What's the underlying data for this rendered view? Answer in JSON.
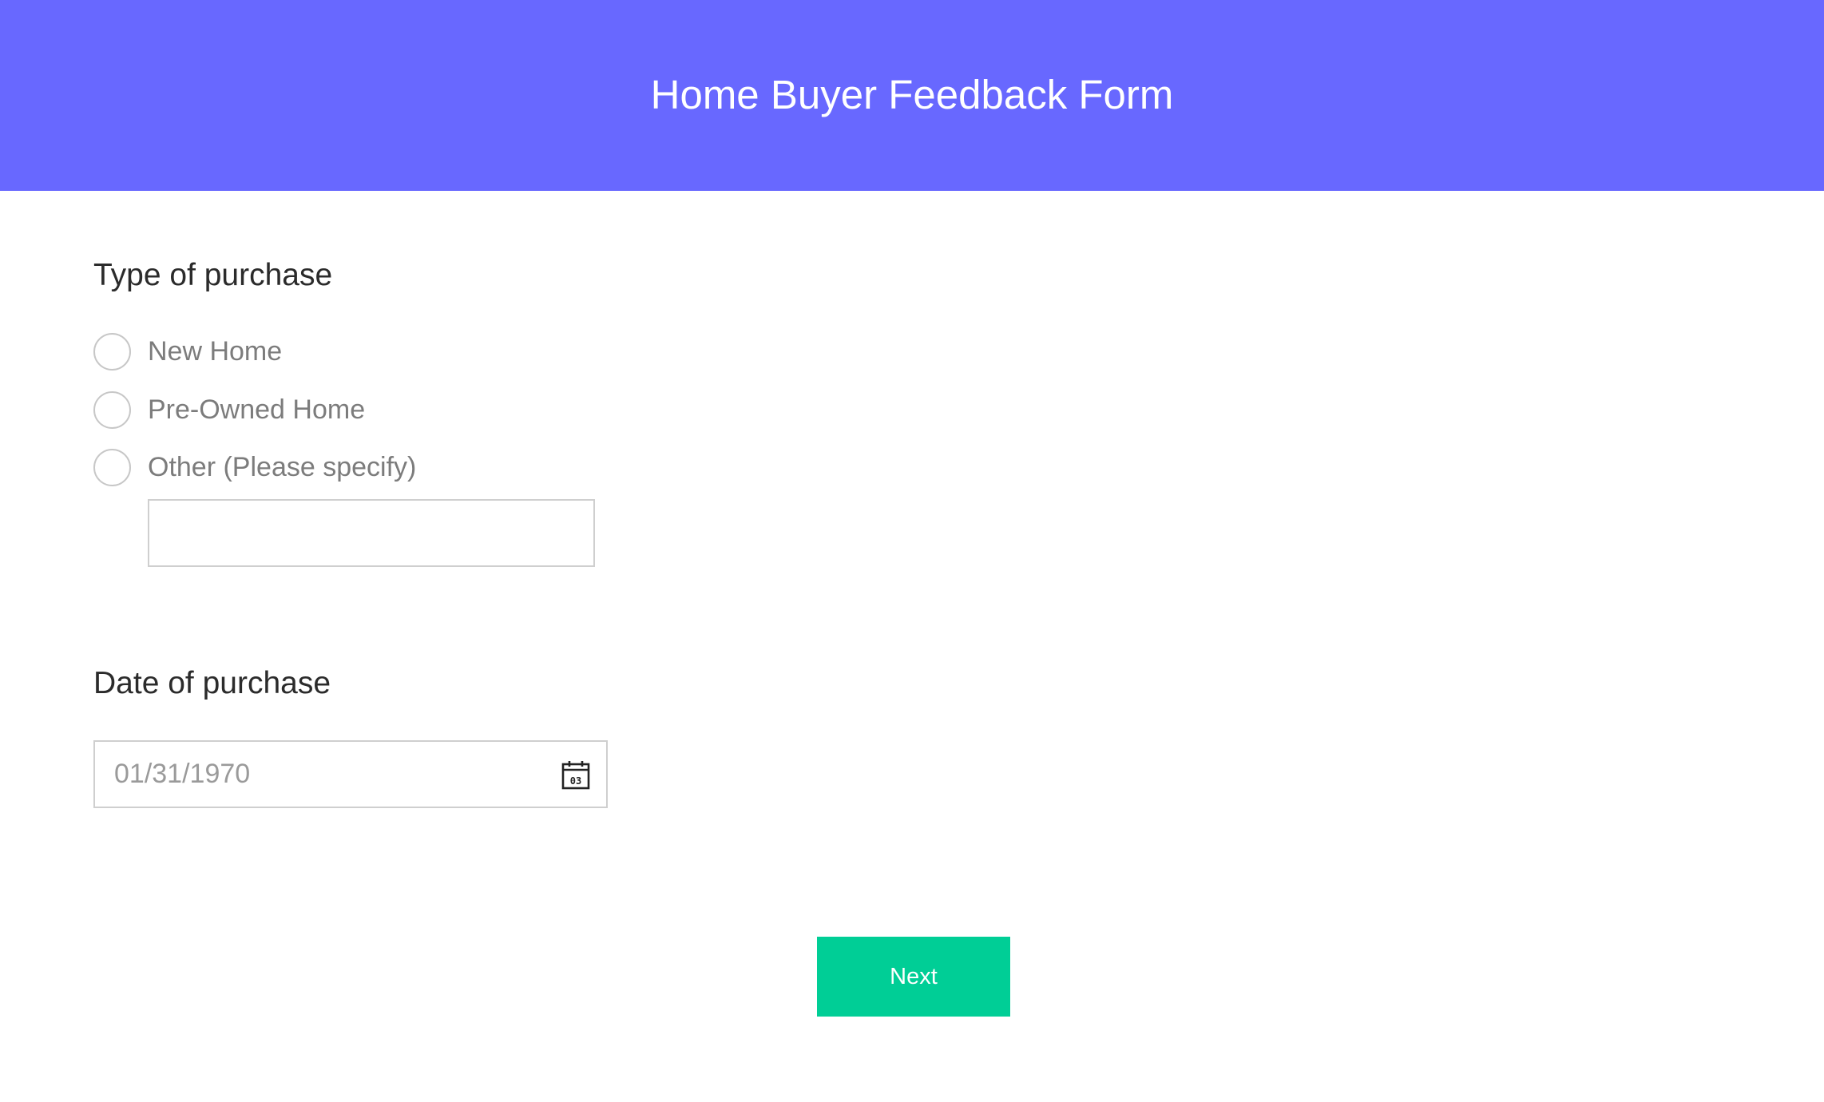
{
  "header": {
    "title": "Home Buyer Feedback Form",
    "background_color": "#6868ff"
  },
  "type_of_purchase": {
    "title": "Type of purchase",
    "options": [
      {
        "label": "New Home",
        "selected": false
      },
      {
        "label": "Pre-Owned Home",
        "selected": false
      },
      {
        "label": "Other (Please specify)",
        "selected": false
      }
    ],
    "other_specify_value": ""
  },
  "date_of_purchase": {
    "title": "Date of purchase",
    "placeholder": "01/31/1970",
    "value": "",
    "icon": "calendar-icon",
    "icon_day_text": "03"
  },
  "next_button": {
    "label": "Next",
    "color": "#00ce96"
  }
}
